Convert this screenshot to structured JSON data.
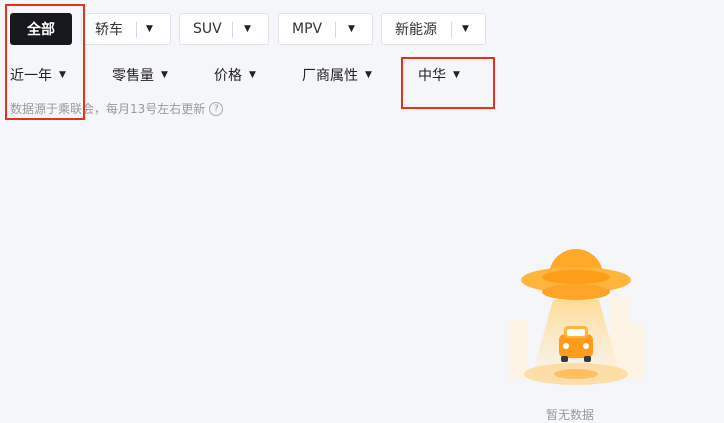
{
  "tabs": [
    {
      "label": "全部",
      "active": true
    },
    {
      "label": "轿车",
      "dropdown": true
    },
    {
      "label": "SUV",
      "dropdown": true
    },
    {
      "label": "MPV",
      "dropdown": true
    },
    {
      "label": "新能源",
      "dropdown": true
    }
  ],
  "filters": [
    {
      "label": "近一年"
    },
    {
      "label": "零售量"
    },
    {
      "label": "价格"
    },
    {
      "label": "厂商属性"
    },
    {
      "label": "中华"
    }
  ],
  "caret_glyph": "▼",
  "note": "数据源于乘联会，每月13号左右更新",
  "help_glyph": "?",
  "empty_state": {
    "icon": "ufo-car-icon",
    "text": "暂无数据"
  },
  "colors": {
    "highlight": "#e0341f",
    "active_tab": "#16181d",
    "accent": "#ff9d1b"
  }
}
